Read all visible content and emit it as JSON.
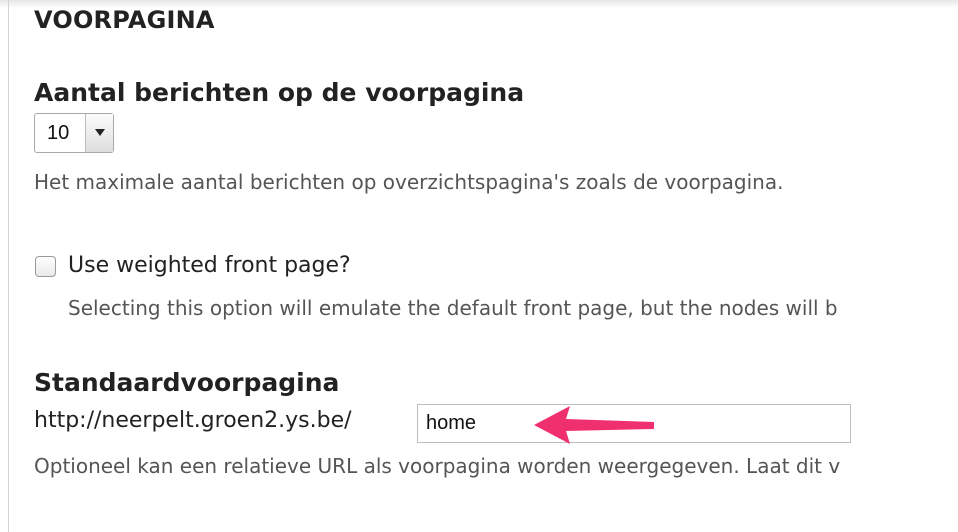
{
  "section": {
    "title": "VOORPAGINA"
  },
  "posts_per_page": {
    "label": "Aantal berichten op de voorpagina",
    "selected_value": "10",
    "description": "Het maximale aantal berichten op overzichtspagina's zoals de voorpagina."
  },
  "weighted_front_page": {
    "label": "Use weighted front page?",
    "checked": false,
    "description": "Selecting this option will emulate the default front page, but the nodes will b"
  },
  "default_front_page": {
    "label": "Standaardvoorpagina",
    "url_prefix": "http://neerpelt.groen2.ys.be/",
    "input_value": "home",
    "description": "Optioneel kan een relatieve URL als voorpagina worden weergegeven. Laat dit v"
  },
  "annotation": {
    "arrow_color": "#f0306e"
  },
  "icons": {
    "select_arrow": "chevron-down-icon",
    "annotation_arrow": "arrow-left-icon"
  }
}
